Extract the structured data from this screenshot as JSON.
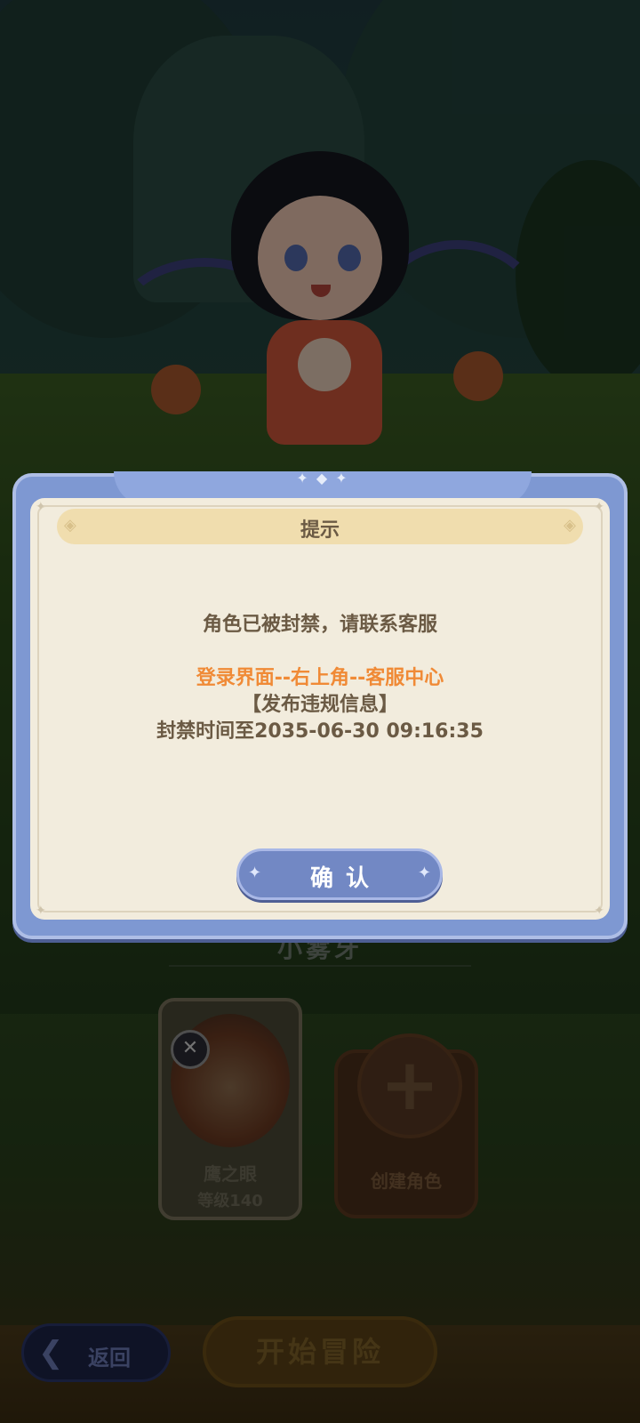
{
  "scene": {
    "character_name_faded": "小雾牙",
    "card": {
      "name": "鹰之眼",
      "level": "等级140"
    },
    "create_card": {
      "label": "创建角色",
      "plus": "+"
    },
    "back_button": {
      "label": "返回",
      "arrow": "❮"
    },
    "start_button": {
      "label": "开始冒险"
    }
  },
  "dialog": {
    "title": "提示",
    "message_line1": "角色已被封禁，请联系客服",
    "message_line2": "登录界面--右上角--客服中心",
    "message_line3": "【发布违规信息】",
    "message_line4": "封禁时间至2035-06-30  09:16:35",
    "confirm_label": "确认"
  },
  "colors": {
    "dialog_frame": "#7e98d2",
    "dialog_panel": "#f2ecdd",
    "title_bar": "#f0ddae",
    "text_brown": "#6b5a44",
    "highlight_orange": "#f08a36",
    "confirm_button": "#7288c4"
  },
  "icons": {
    "ornament": "sparkle-diamond-icon",
    "back": "chevron-left-icon",
    "create": "plus-icon",
    "badge": "crossed-swords-icon"
  }
}
